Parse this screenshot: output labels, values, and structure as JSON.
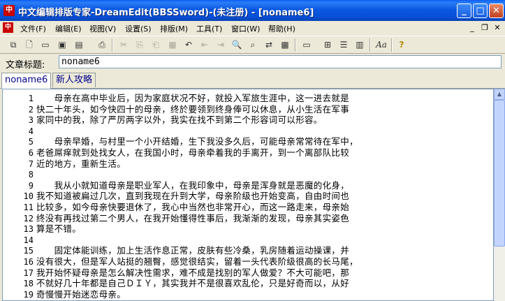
{
  "window": {
    "title": "中文编辑排版专家-DreamEdit(BBSSword)-(未注册) - [noname6]",
    "app_icon_text": "中"
  },
  "menu": [
    "文件(F)",
    "编辑(E)",
    "视图(V)",
    "设置(S)",
    "排版(M)",
    "工具(T)",
    "窗口(W)",
    "帮助(H)"
  ],
  "title_field": {
    "label": "文章标题:",
    "value": "noname6"
  },
  "tabs": [
    "noname6",
    "新人攻略"
  ],
  "editor": {
    "lines": [
      {
        "n": "1",
        "text": "　　母亲在高中毕业后，因为家庭状况不好，就投入军旅生涯中，这一进去就是"
      },
      {
        "n": "2",
        "text": "快二十年头，如今快四十的母亲，终於要领到终身俸可以休息，从小生活在军事"
      },
      {
        "n": "3",
        "text": "家同中的我，除了严厉两字以外，我实在找不到第二个形容词可以形容。"
      },
      {
        "n": "4",
        "text": ""
      },
      {
        "n": "5",
        "text": "　　母亲早婚，与村里一个小开结婚，生下我没多久后，可能母亲常常待在军中，"
      },
      {
        "n": "6",
        "text": "老爸屌痒就到处找女人，在我国小时，母亲牵着我的手离开，到一个离部队比较"
      },
      {
        "n": "7",
        "text": "近的地方，重新生活。"
      },
      {
        "n": "8",
        "text": ""
      },
      {
        "n": "9",
        "text": "　　我从小就知道母亲是职业军人，在我印象中，母亲是浑身就是恶魔的化身，"
      },
      {
        "n": "10",
        "text": "我不知道被扁过几次，直到我现在升到大学，母亲阶级也开始变高，自由时间也"
      },
      {
        "n": "11",
        "text": "比较多，如今母亲快要退休了，我心中当然也非常开心，而这一路走来，母亲始"
      },
      {
        "n": "12",
        "text": "终没有再找过第二个男人，在我开始懂得性事后，我渐渐的发现，母亲其实姿色"
      },
      {
        "n": "13",
        "text": "算是不错。"
      },
      {
        "n": "14",
        "text": ""
      },
      {
        "n": "15",
        "text": "　　固定体能训练，加上生活作息正常，皮肤有些冷桑，乳房随着运动操课，并"
      },
      {
        "n": "16",
        "text": "没有很大，但是军人站挺的翘臀，感觉很结实，留着一头代表阶级很高的长马尾，"
      },
      {
        "n": "17",
        "text": "我开始怀疑母亲是怎么解决性需求，难不成是找别的军人做爱？不大可能吧，那"
      },
      {
        "n": "18",
        "text": "不就好几十年都是自己ＤＩＹ，其实我并不是很喜欢乱伦，只是好奇而以，从好"
      },
      {
        "n": "19",
        "text": "奇慢慢开始迷恋母亲。"
      },
      {
        "n": "20",
        "text": ""
      }
    ]
  },
  "icons": {
    "toolbar": [
      "new-window-icon",
      "new-file-icon",
      "open-folder-icon",
      "save-icon",
      "bookmark-icon",
      "print-icon",
      "cut-icon",
      "copy-icon",
      "paste-icon",
      "undo-icon",
      "indent-left-icon",
      "indent-right-icon",
      "find-icon",
      "find-in-files-icon",
      "replace-icon",
      "select-all-icon",
      "format-icon",
      "table-icon",
      "layout-icon",
      "columns-icon",
      "font-icon",
      "help-icon"
    ]
  }
}
